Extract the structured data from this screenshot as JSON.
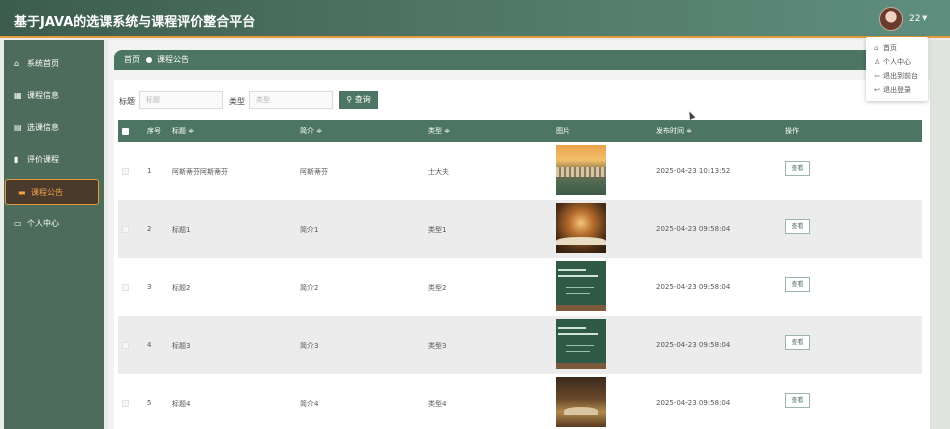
{
  "header": {
    "app_title": "基于JAVA的选课系统与课程评价整合平台",
    "user_name": "22"
  },
  "user_menu": {
    "items": [
      {
        "icon": "home-icon",
        "label": "首页"
      },
      {
        "icon": "user-icon",
        "label": "个人中心"
      },
      {
        "icon": "back-icon",
        "label": "退出到前台"
      },
      {
        "icon": "logout-icon",
        "label": "退出登录"
      }
    ]
  },
  "sidebar": {
    "items": [
      {
        "icon": "home-icon",
        "label": "系统首页",
        "active": false
      },
      {
        "icon": "grid-icon",
        "label": "课程信息",
        "active": false
      },
      {
        "icon": "document-icon",
        "label": "选课信息",
        "active": false
      },
      {
        "icon": "bar-chart-icon",
        "label": "评价课程",
        "active": false
      },
      {
        "icon": "announcement-icon",
        "label": "课程公告",
        "active": true
      },
      {
        "icon": "id-card-icon",
        "label": "个人中心",
        "active": false
      }
    ]
  },
  "breadcrumb": {
    "home": "首页",
    "current": "课程公告"
  },
  "search": {
    "title_label": "标题",
    "title_placeholder": "标题",
    "type_label": "类型",
    "type_placeholder": "类型",
    "button_label": "查询"
  },
  "table": {
    "headers": {
      "index": "序号",
      "title": "标题 ≑",
      "intro": "简介 ≑",
      "type": "类型 ≑",
      "image": "图片",
      "publish_time": "发布时间 ≑",
      "actions": "操作"
    },
    "rows": [
      {
        "index": "1",
        "title": "阿斯蒂芬阿斯蒂芬",
        "intro": "阿斯蒂芬",
        "type": "士大夫",
        "image": "campus-sunset-photo",
        "publish_time": "2025-04-23 10:13:52",
        "action": "查看"
      },
      {
        "index": "2",
        "title": "标题1",
        "intro": "简介1",
        "type": "类型1",
        "image": "glowing-book-photo",
        "publish_time": "2025-04-23 09:58:04",
        "action": "查看"
      },
      {
        "index": "3",
        "title": "标题2",
        "intro": "简介2",
        "type": "类型2",
        "image": "chalkboard-photo",
        "publish_time": "2025-04-23 09:58:04",
        "action": "查看"
      },
      {
        "index": "4",
        "title": "标题3",
        "intro": "简介3",
        "type": "类型3",
        "image": "chalkboard-photo",
        "publish_time": "2025-04-23 09:58:04",
        "action": "查看"
      },
      {
        "index": "5",
        "title": "标题4",
        "intro": "简介4",
        "type": "类型4",
        "image": "books-on-desk-photo",
        "publish_time": "2025-04-23 09:58:04",
        "action": "查看"
      }
    ]
  },
  "colors": {
    "primary": "#4d7564",
    "sidebar": "#4d6c5c",
    "accent": "#e79a3a",
    "active_bg": "#4a3a2c"
  }
}
